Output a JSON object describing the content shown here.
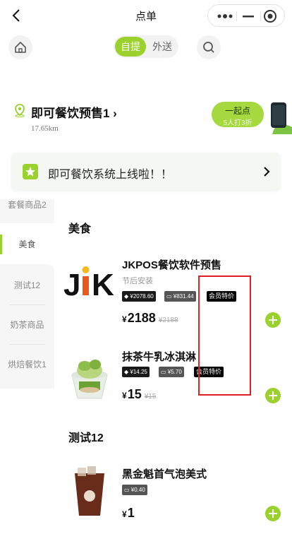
{
  "header": {
    "title": "点单"
  },
  "mode": {
    "active": "自提",
    "other": "外送"
  },
  "store": {
    "name": "即可餐饮预售1 ›",
    "distance": "17.65km"
  },
  "group_buy": {
    "title": "一起点",
    "subtitle": "5人打3折"
  },
  "notice": {
    "text": "即可餐饮系统上线啦！！"
  },
  "sidebar": {
    "items": [
      {
        "label": "套餐商品2"
      },
      {
        "label": "美食"
      },
      {
        "label": "测试12"
      },
      {
        "label": "奶茶商品"
      },
      {
        "label": "烘焙餐饮1"
      }
    ]
  },
  "sections": [
    {
      "title": "美食",
      "products": [
        {
          "name": "JKPOS餐饮软件预售",
          "subtitle": "节后安装",
          "logo_text": "JK",
          "tags": [
            "¥2078.60",
            "¥831.44"
          ],
          "member_tag": "会员特价",
          "price": "2188",
          "price_old": "¥2188"
        },
        {
          "name": "抹茶牛乳冰淇淋",
          "tags": [
            "¥14.25",
            "¥5.70"
          ],
          "member_tag": "会员特价",
          "price": "15",
          "price_old": "¥15"
        }
      ]
    },
    {
      "title": "测试12",
      "products": [
        {
          "name": "黑金魁首气泡美式",
          "tags": [
            "¥0.40"
          ],
          "price": "1"
        }
      ]
    }
  ],
  "currency": "¥",
  "colors": {
    "accent": "#9bd12c",
    "highlight_box": "#e02020"
  }
}
